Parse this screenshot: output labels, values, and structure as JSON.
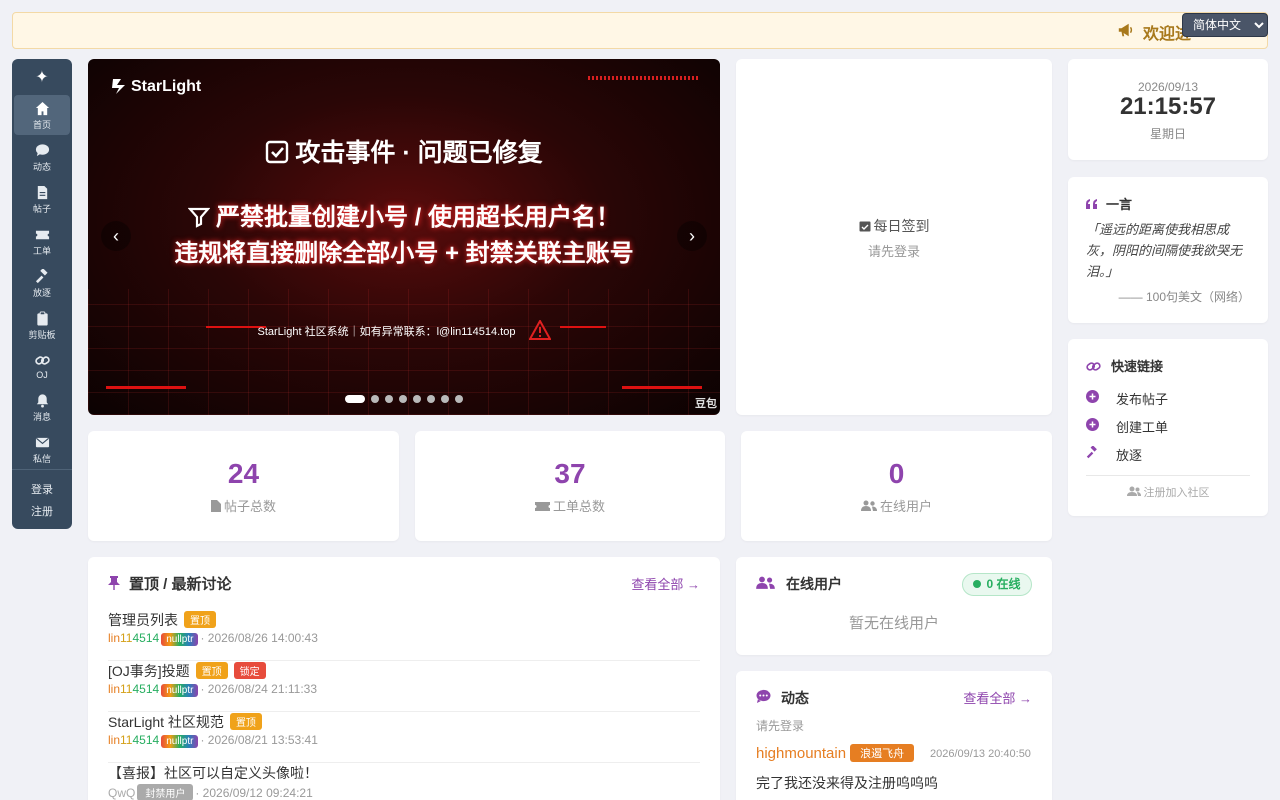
{
  "announcement": {
    "text": "欢迎进"
  },
  "language": {
    "selected": "简体中文"
  },
  "sidebar": {
    "items": [
      {
        "label": "首页"
      },
      {
        "label": "动态"
      },
      {
        "label": "帖子"
      },
      {
        "label": "工单"
      },
      {
        "label": "放逐"
      },
      {
        "label": "剪贴板"
      },
      {
        "label": "OJ"
      },
      {
        "label": "消息"
      },
      {
        "label": "私信"
      }
    ],
    "login": "登录",
    "register": "注册"
  },
  "banner": {
    "brand": "StarLight",
    "title1": "攻击事件 · 问题已修复",
    "title2": "严禁批量创建小号 / 使用超长用户名！",
    "title3": "违规将直接删除全部小号 + 封禁关联主账号",
    "contact": "StarLight 社区系统｜如有异常联系：l@lin114514.top",
    "watermark": "豆包",
    "slide_count": 8,
    "active_slide": 1
  },
  "checkin": {
    "title": "每日签到",
    "subtitle": "请先登录"
  },
  "clock": {
    "date": "2026/09/13",
    "time": "21:15:57",
    "weekday": "星期日"
  },
  "quote": {
    "title": "一言",
    "text": "「遥远的距离使我相思成灰，阴阳的间隔使我欲哭无泪。」",
    "source": "—— 100句美文（网络）"
  },
  "quick_links": {
    "title": "快速链接",
    "items": [
      {
        "label": "发布帖子"
      },
      {
        "label": "创建工单"
      },
      {
        "label": "放逐"
      }
    ],
    "register": "注册加入社区"
  },
  "stats": [
    {
      "value": "24",
      "label": "帖子总数"
    },
    {
      "value": "37",
      "label": "工单总数"
    },
    {
      "value": "0",
      "label": "在线用户"
    }
  ],
  "discussions": {
    "title": "置顶 / 最新讨论",
    "view_all": "查看全部 →",
    "posts": [
      {
        "title": "管理员列表",
        "pin": "置顶",
        "author": [
          "lin",
          "11",
          "45",
          "14"
        ],
        "tag": "nullptr",
        "time": "· 2026/08/26 14:00:43"
      },
      {
        "title": "[OJ事务]投题",
        "pin": "置顶",
        "lock": "锁定",
        "author": [
          "lin",
          "11",
          "45",
          "14"
        ],
        "tag": "nullptr",
        "time": "· 2026/08/24 21:11:33"
      },
      {
        "title": "StarLight 社区规范",
        "pin": "置顶",
        "author": [
          "lin",
          "11",
          "45",
          "14"
        ],
        "tag": "nullptr",
        "time": "· 2026/08/21 13:53:41"
      },
      {
        "title": "【喜报】社区可以自定义头像啦！",
        "author_plain": "QwQ",
        "tag": "封禁用户",
        "time": "· 2026/09/12 09:24:21"
      }
    ]
  },
  "online": {
    "title": "在线用户",
    "badge": "0 在线",
    "empty": "暂无在线用户"
  },
  "activity": {
    "title": "动态",
    "view_all": "查看全部 →",
    "login_hint": "请先登录",
    "user": "highmountain",
    "user_tag": "浪遏飞舟",
    "time": "2026/09/13 20:40:50",
    "message": "完了我还没来得及注册呜呜呜"
  },
  "colors": {
    "accent": "#8e44ad",
    "sidebar": "#374a5e",
    "pin": "#f0a21a",
    "lock": "#e74c3c",
    "online": "#27ae60"
  }
}
